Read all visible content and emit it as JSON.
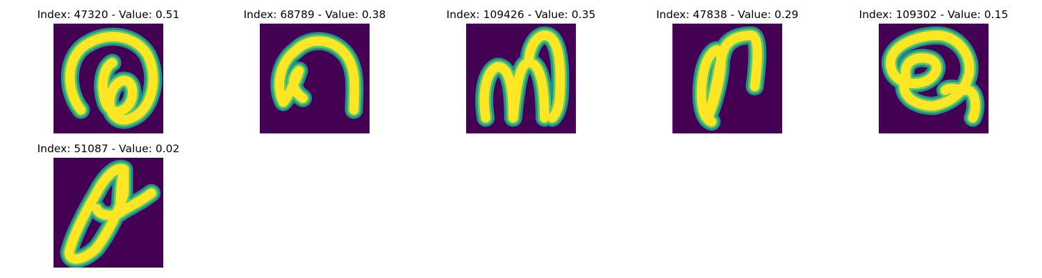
{
  "colors": {
    "background": "#440154",
    "stroke_edge": "#21918c",
    "stroke_mid": "#5ec962",
    "stroke_core": "#fde725"
  },
  "panels": [
    {
      "title": "Index: 47320 - Value: 0.51",
      "glyph": "curl-a-icon"
    },
    {
      "title": "Index: 68789 - Value: 0.38",
      "glyph": "arch-n-icon"
    },
    {
      "title": "Index: 109426 - Value: 0.35",
      "glyph": "m-shape-icon"
    },
    {
      "title": "Index: 47838 - Value: 0.29",
      "glyph": "loop-n-icon"
    },
    {
      "title": "Index: 109302 - Value: 0.15",
      "glyph": "loop-q-icon"
    },
    {
      "title": "Index: 51087 - Value: 0.02",
      "glyph": "slanted-a-icon"
    }
  ]
}
